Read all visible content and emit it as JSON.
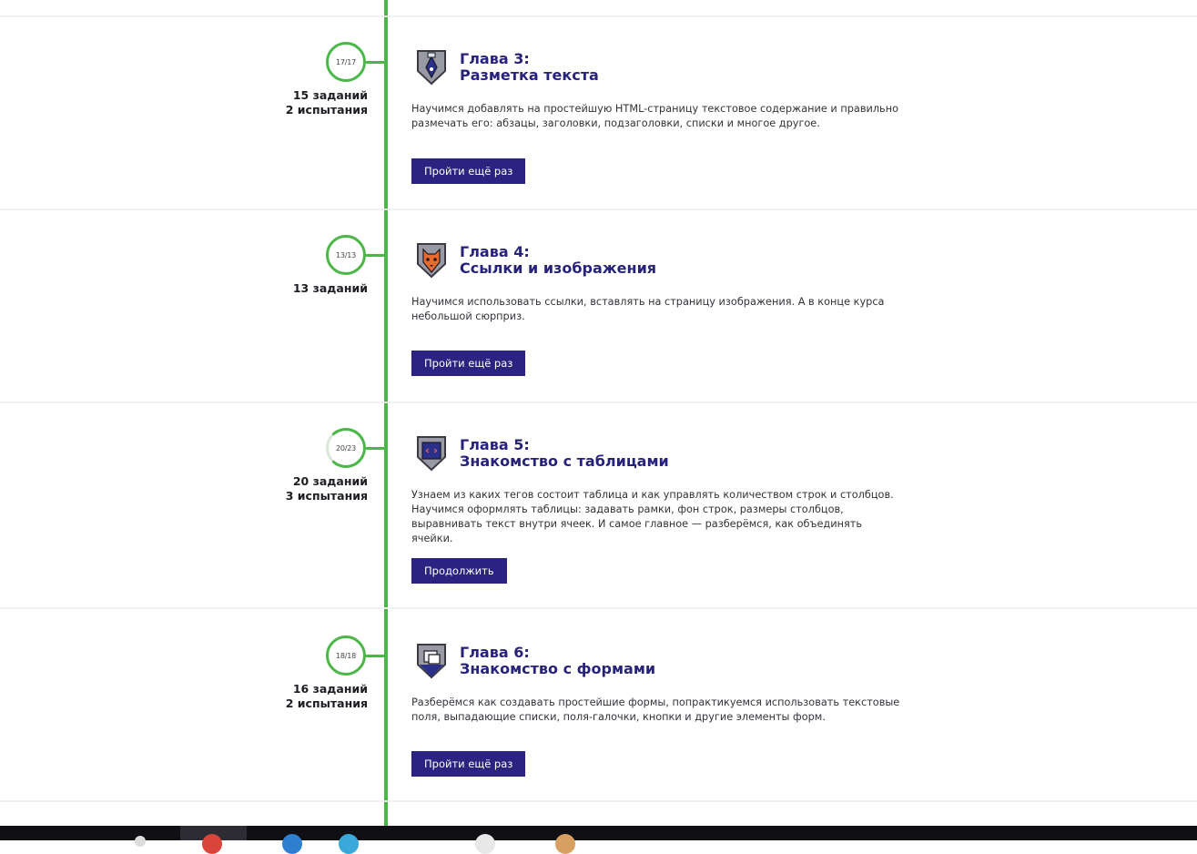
{
  "colors": {
    "timeline": "#4cb648",
    "title": "#28237a",
    "button": "#2a2480",
    "button_text": "#ffffff",
    "separator": "#f1f1f3",
    "taskbar": "#101014"
  },
  "chapters": [
    {
      "progress": "17/17",
      "progress_fraction": 1.0,
      "tasks": "15 заданий",
      "tests": "2 испытания",
      "title_line1": "Глава 3:",
      "title_line2": "Разметка текста",
      "icon": "pen-nib-icon",
      "description": "Научимся добавлять на простейшую HTML-страницу текстовое содержание и правильно размечать его: абзацы, заголовки, подзаголовки, списки и многое другое.",
      "button": "Пройти ещё раз"
    },
    {
      "progress": "13/13",
      "progress_fraction": 1.0,
      "tasks": "13 заданий",
      "title_line1": "Глава 4:",
      "title_line2": "Ссылки и изображения",
      "icon": "cat-icon",
      "description": "Научимся использовать ссылки, вставлять на страницу изображения. А в конце курса небольшой сюрприз.",
      "button": "Пройти ещё раз"
    },
    {
      "progress": "20/23",
      "progress_fraction": 0.87,
      "tasks": "20 заданий",
      "tests": "3 испытания",
      "title_line1": "Глава 5:",
      "title_line2": "Знакомство с таблицами",
      "icon": "table-icon",
      "description": "Узнаем из каких тегов состоит таблица и как управлять количеством строк и столбцов. Научимся оформлять таблицы: задавать рамки, фон строк, размеры столбцов, выравнивать текст внутри ячеек. И самое главное — разберёмся, как объединять ячейки.",
      "button": "Продолжить"
    },
    {
      "progress": "18/18",
      "progress_fraction": 1.0,
      "tasks": "16 заданий",
      "tests": "2 испытания",
      "title_line1": "Глава 6:",
      "title_line2": "Знакомство с формами",
      "icon": "forms-icon",
      "description": "Разберёмся как создавать простейшие формы, попрактикуемся использовать текстовые поля, выпадающие списки, поля-галочки, кнопки и другие элементы форм.",
      "button": "Пройти ещё раз"
    }
  ]
}
